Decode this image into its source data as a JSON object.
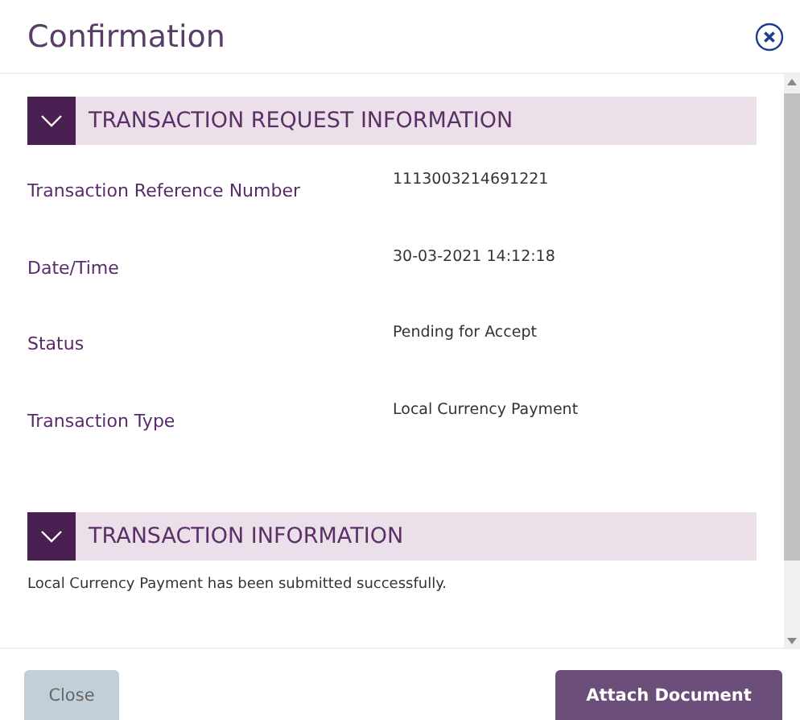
{
  "dialog": {
    "title": "Confirmation"
  },
  "sections": [
    {
      "title": "TRANSACTION REQUEST INFORMATION",
      "expanded": true,
      "fields": [
        {
          "label": "Transaction Reference Number",
          "value": "1113003214691221"
        },
        {
          "label": "Date/Time",
          "value": "30-03-2021 14:12:18"
        },
        {
          "label": "Status",
          "value": "Pending for Accept"
        },
        {
          "label": "Transaction Type",
          "value": "Local Currency Payment"
        }
      ]
    },
    {
      "title": "TRANSACTION INFORMATION",
      "expanded": true,
      "message": "Local Currency Payment has been submitted successfully."
    }
  ],
  "buttons": [
    {
      "label": "Close",
      "kind": "secondary"
    },
    {
      "label": "Attach Document",
      "kind": "primary"
    }
  ]
}
